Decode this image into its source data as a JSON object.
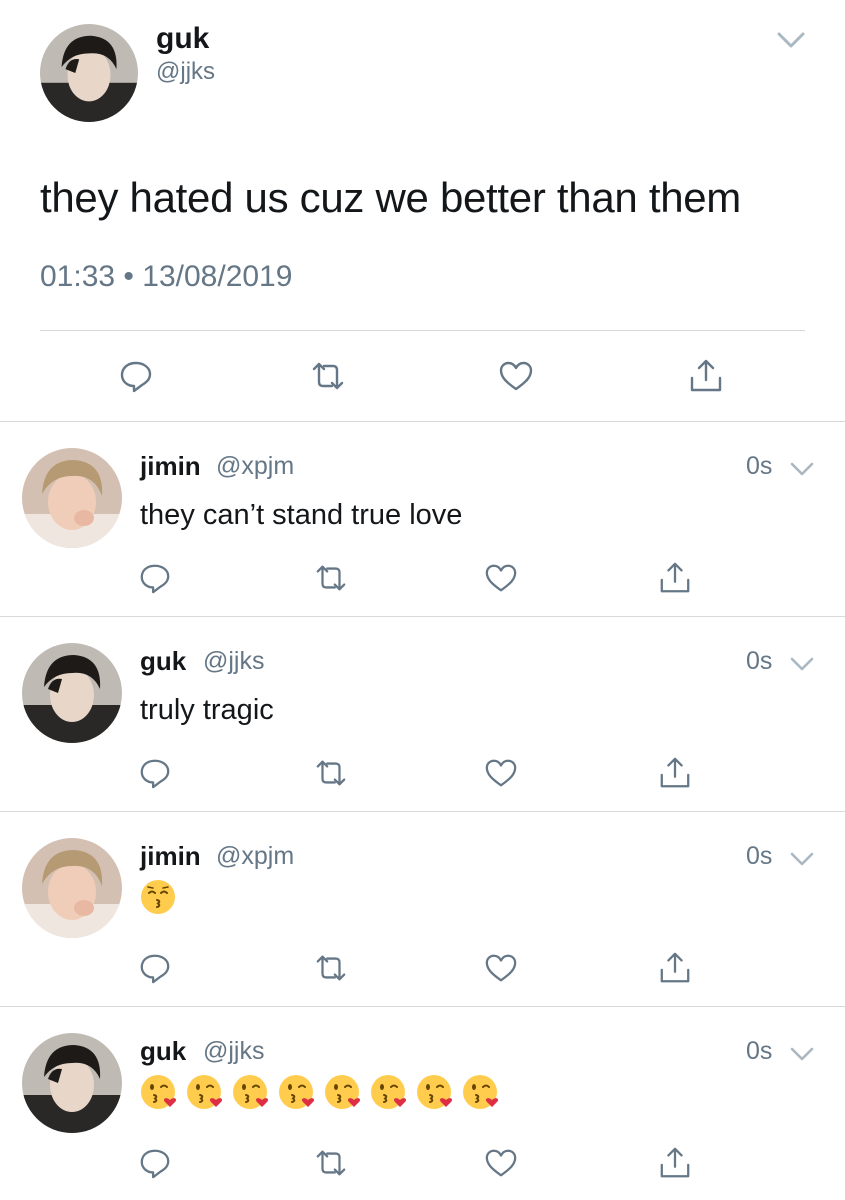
{
  "main_tweet": {
    "name": "guk",
    "handle": "@jjks",
    "text": "they hated us cuz we better than them",
    "time": "01:33",
    "separator": "•",
    "date": "13/08/2019",
    "icons": [
      "chevron-down-icon",
      "reply-icon",
      "retweet-icon",
      "like-icon",
      "share-icon"
    ]
  },
  "replies": [
    {
      "name": "jimin",
      "handle": "@xpjm",
      "time": "0s",
      "text": "they can’t stand true love",
      "emoji": null,
      "emoji_count": 0
    },
    {
      "name": "guk",
      "handle": "@jjks",
      "time": "0s",
      "text": "truly tragic",
      "emoji": null,
      "emoji_count": 0
    },
    {
      "name": "jimin",
      "handle": "@xpjm",
      "time": "0s",
      "text": "",
      "emoji": "kissing-closed-eyes-emoji",
      "emoji_count": 1
    },
    {
      "name": "guk",
      "handle": "@jjks",
      "time": "0s",
      "text": "",
      "emoji": "face-blowing-kiss-emoji",
      "emoji_count": 8
    }
  ],
  "colors": {
    "text": "#14171a",
    "secondary": "#657786",
    "divider": "#d9d9d9",
    "icon": "#657786"
  }
}
